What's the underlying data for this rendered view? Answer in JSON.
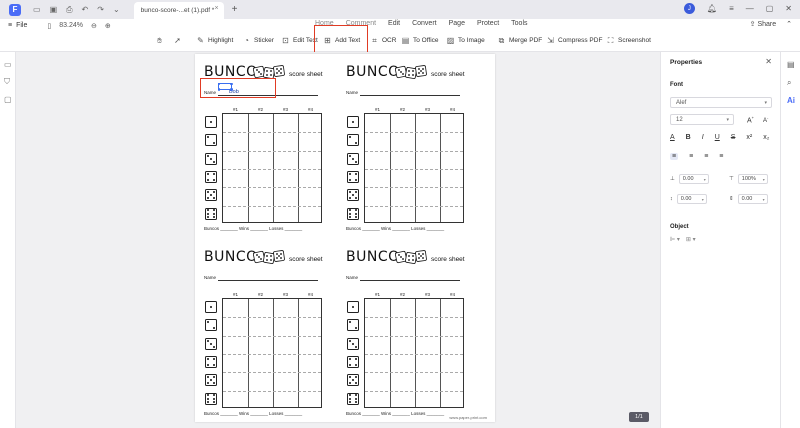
{
  "titlebar": {
    "app_logo": "F",
    "tab_title": "bunco-score-...et (1).pdf *",
    "tab_close": "×",
    "tab_add": "+",
    "avatar": "J",
    "icons": [
      "folder-icon",
      "save-icon",
      "print-icon",
      "undo-icon",
      "redo-icon",
      "chevron-down-icon"
    ]
  },
  "menubar": {
    "file_label": "File",
    "zoom_value": "83.24%",
    "items": [
      "Home",
      "Comment",
      "Edit",
      "Convert",
      "Page",
      "Protect",
      "Tools"
    ],
    "share_label": "Share"
  },
  "toolbar": {
    "items": [
      {
        "label": "Highlight",
        "icon": "highlighter-icon"
      },
      {
        "label": "Sticker",
        "icon": "sticker-icon"
      },
      {
        "label": "Edit Text",
        "icon": "edit-text-icon"
      },
      {
        "label": "Add Text",
        "icon": "add-text-icon"
      },
      {
        "label": "OCR",
        "icon": "ocr-icon"
      },
      {
        "label": "To Office",
        "icon": "to-office-icon"
      },
      {
        "label": "To Image",
        "icon": "to-image-icon"
      },
      {
        "label": "Merge PDF",
        "icon": "merge-icon"
      },
      {
        "label": "Compress PDF",
        "icon": "compress-icon"
      },
      {
        "label": "Screenshot",
        "icon": "screenshot-icon"
      }
    ]
  },
  "document": {
    "sheet_title": "BUNCO",
    "sheet_subtitle": "score sheet",
    "name_label": "Name",
    "name_value": "Bob",
    "columns": [
      "#1",
      "#2",
      "#3",
      "#4"
    ],
    "footer_buncos": "Buncos _______",
    "footer_wins": "Wins _______",
    "footer_losses": "Losses _______",
    "watermark": "www.paper-print.com",
    "page_indicator": "1/1"
  },
  "properties": {
    "title": "Properties",
    "font_section": "Font",
    "font_family": "Alef",
    "font_size": "12",
    "size_up": "A",
    "size_down": "A",
    "style_buttons": [
      "A",
      "B",
      "I",
      "U",
      "S"
    ],
    "char_spacing": "0.00",
    "scale": "100%",
    "line_spacing": "0.00",
    "para_spacing": "0.00",
    "object_section": "Object"
  },
  "colors": {
    "accent": "#4a6cf7",
    "annotation_red": "#e03b24",
    "selection_blue": "#3a6ff0"
  }
}
